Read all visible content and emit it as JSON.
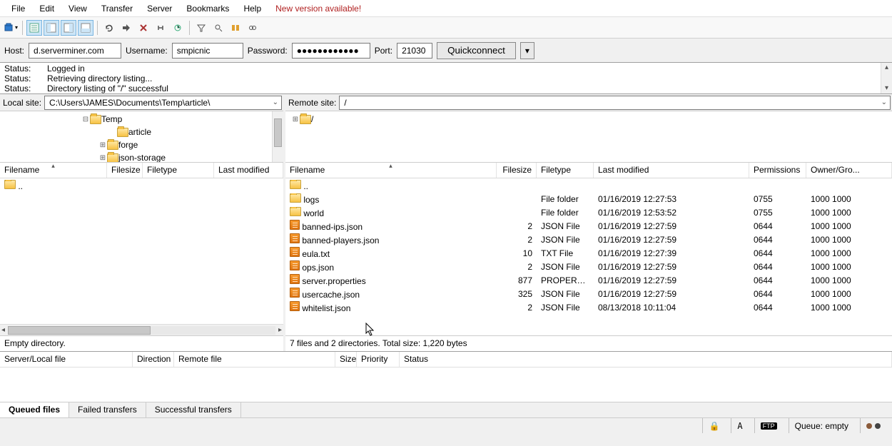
{
  "menu": {
    "file": "File",
    "edit": "Edit",
    "view": "View",
    "transfer": "Transfer",
    "server": "Server",
    "bookmarks": "Bookmarks",
    "help": "Help",
    "newversion": "New version available!"
  },
  "quick": {
    "host_label": "Host:",
    "host": "d.serverminer.com",
    "user_label": "Username:",
    "user": "smpicnic",
    "pass_label": "Password:",
    "pass": "●●●●●●●●●●●●",
    "port_label": "Port:",
    "port": "21030",
    "button": "Quickconnect"
  },
  "log": [
    {
      "lbl": "Status:",
      "msg": "Logged in"
    },
    {
      "lbl": "Status:",
      "msg": "Retrieving directory listing..."
    },
    {
      "lbl": "Status:",
      "msg": "Directory listing of \"/\" successful"
    }
  ],
  "local": {
    "label": "Local site:",
    "path": "C:\\Users\\JAMES\\Documents\\Temp\\article\\",
    "tree": [
      {
        "indent": 114,
        "exp": "⊟",
        "name": "Temp"
      },
      {
        "indent": 152,
        "exp": "",
        "name": "article"
      },
      {
        "indent": 138,
        "exp": "⊞",
        "name": "forge"
      },
      {
        "indent": 138,
        "exp": "⊞",
        "name": "json-storage"
      }
    ],
    "cols": {
      "name": "Filename",
      "size": "Filesize",
      "type": "Filetype",
      "mod": "Last modified"
    },
    "rows": [
      {
        "name": ".."
      }
    ],
    "status": "Empty directory."
  },
  "remote": {
    "label": "Remote site:",
    "path": "/",
    "tree": [
      {
        "indent": 8,
        "exp": "⊞",
        "name": "/"
      }
    ],
    "cols": {
      "name": "Filename",
      "size": "Filesize",
      "type": "Filetype",
      "mod": "Last modified",
      "perm": "Permissions",
      "owner": "Owner/Gro..."
    },
    "rows": [
      {
        "icon": "folder",
        "name": "..",
        "size": "",
        "type": "",
        "mod": "",
        "perm": "",
        "owner": ""
      },
      {
        "icon": "folder",
        "name": "logs",
        "size": "",
        "type": "File folder",
        "mod": "01/16/2019 12:27:53",
        "perm": "0755",
        "owner": "1000 1000"
      },
      {
        "icon": "folder",
        "name": "world",
        "size": "",
        "type": "File folder",
        "mod": "01/16/2019 12:53:52",
        "perm": "0755",
        "owner": "1000 1000"
      },
      {
        "icon": "file",
        "name": "banned-ips.json",
        "size": "2",
        "type": "JSON File",
        "mod": "01/16/2019 12:27:59",
        "perm": "0644",
        "owner": "1000 1000"
      },
      {
        "icon": "file",
        "name": "banned-players.json",
        "size": "2",
        "type": "JSON File",
        "mod": "01/16/2019 12:27:59",
        "perm": "0644",
        "owner": "1000 1000"
      },
      {
        "icon": "file",
        "name": "eula.txt",
        "size": "10",
        "type": "TXT File",
        "mod": "01/16/2019 12:27:39",
        "perm": "0644",
        "owner": "1000 1000"
      },
      {
        "icon": "file",
        "name": "ops.json",
        "size": "2",
        "type": "JSON File",
        "mod": "01/16/2019 12:27:59",
        "perm": "0644",
        "owner": "1000 1000"
      },
      {
        "icon": "file",
        "name": "server.properties",
        "size": "877",
        "type": "PROPERTIE...",
        "mod": "01/16/2019 12:27:59",
        "perm": "0644",
        "owner": "1000 1000"
      },
      {
        "icon": "file",
        "name": "usercache.json",
        "size": "325",
        "type": "JSON File",
        "mod": "01/16/2019 12:27:59",
        "perm": "0644",
        "owner": "1000 1000"
      },
      {
        "icon": "file",
        "name": "whitelist.json",
        "size": "2",
        "type": "JSON File",
        "mod": "08/13/2018 10:11:04",
        "perm": "0644",
        "owner": "1000 1000"
      }
    ],
    "status": "7 files and 2 directories. Total size: 1,220 bytes"
  },
  "queue": {
    "cols": {
      "local": "Server/Local file",
      "dir": "Direction",
      "remote": "Remote file",
      "size": "Size",
      "prio": "Priority",
      "status": "Status"
    },
    "tabs": {
      "queued": "Queued files",
      "failed": "Failed transfers",
      "success": "Successful transfers"
    }
  },
  "footer": {
    "queue_label": "Queue: empty"
  }
}
